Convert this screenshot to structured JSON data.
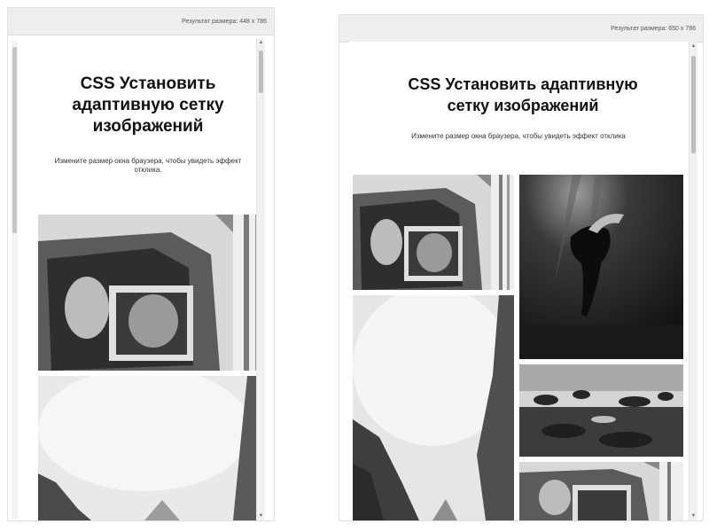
{
  "left_preview": {
    "result_label": "Результат размера: 448 x 786",
    "title": "CSS Установить адаптивную сетку изображений",
    "subtitle": "Измените размер окна браузера, чтобы увидеть эффект отклика."
  },
  "right_preview": {
    "result_label": "Результат размера: 650 x 786",
    "title": "CSS Установить адаптивную сетку изображений",
    "subtitle": "Измените размер окна браузера, чтобы увидеть эффект отклика"
  },
  "icons": {
    "scroll_up": "▲",
    "scroll_down": "▼"
  },
  "colors": {
    "toolbar_bg": "#eeeeee",
    "scrollbar_thumb": "#bdbdbd",
    "photo_dark": "#1e1e1e",
    "photo_light": "#e6e6e6"
  }
}
